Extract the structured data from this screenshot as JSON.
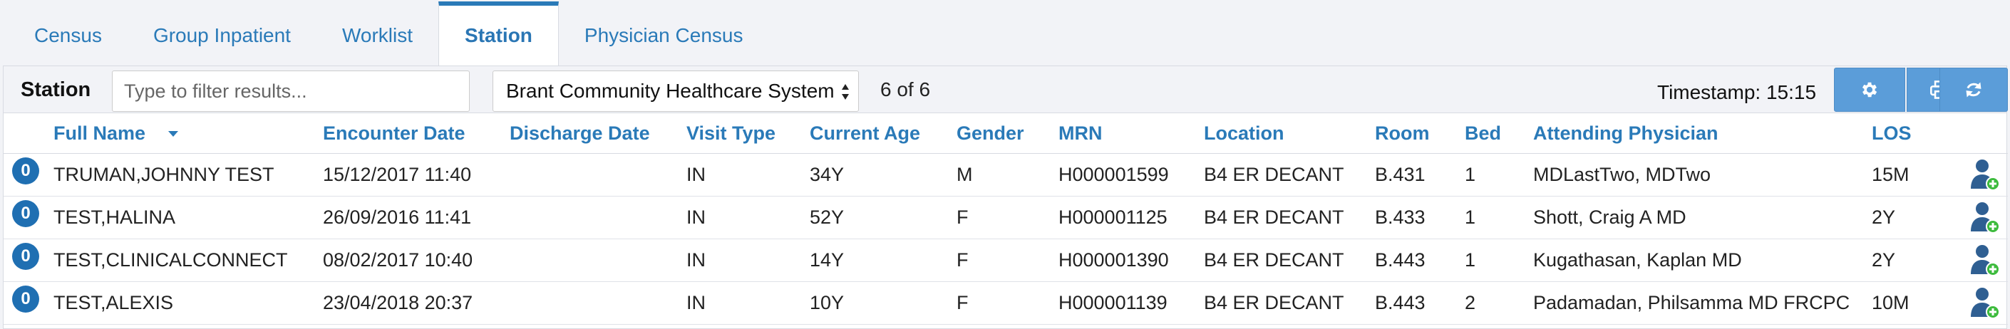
{
  "tabs": [
    {
      "label": "Census",
      "active": false
    },
    {
      "label": "Group Inpatient",
      "active": false
    },
    {
      "label": "Worklist",
      "active": false
    },
    {
      "label": "Station",
      "active": true
    },
    {
      "label": "Physician Census",
      "active": false
    }
  ],
  "toolbar": {
    "title": "Station",
    "filter_placeholder": "Type to filter results...",
    "filter_value": "",
    "system_select": "Brant Community Healthcare System",
    "count": "6 of 6",
    "timestamp": "Timestamp: 15:15",
    "buttons": [
      "gear-icon",
      "print-icon",
      "refresh-icon"
    ]
  },
  "columns": [
    "Full Name",
    "Encounter Date",
    "Discharge Date",
    "Visit Type",
    "Current Age",
    "Gender",
    "MRN",
    "Location",
    "Room",
    "Bed",
    "Attending Physician",
    "LOS"
  ],
  "rows": [
    {
      "badge": "0",
      "name": "TRUMAN,JOHNNY TEST",
      "encounter": "15/12/2017 11:40",
      "discharge": "",
      "visit": "IN",
      "age": "34Y",
      "gender": "M",
      "mrn": "H000001599",
      "location": "B4 ER DECANT",
      "room": "B.431",
      "bed": "1",
      "physician": "MDLastTwo, MDTwo",
      "los": "15M"
    },
    {
      "badge": "0",
      "name": "TEST,HALINA",
      "encounter": "26/09/2016 11:41",
      "discharge": "",
      "visit": "IN",
      "age": "52Y",
      "gender": "F",
      "mrn": "H000001125",
      "location": "B4 ER DECANT",
      "room": "B.433",
      "bed": "1",
      "physician": "Shott, Craig A MD",
      "los": "2Y"
    },
    {
      "badge": "0",
      "name": "TEST,CLINICALCONNECT",
      "encounter": "08/02/2017 10:40",
      "discharge": "",
      "visit": "IN",
      "age": "14Y",
      "gender": "F",
      "mrn": "H000001390",
      "location": "B4 ER DECANT",
      "room": "B.443",
      "bed": "1",
      "physician": "Kugathasan, Kaplan MD",
      "los": "2Y"
    },
    {
      "badge": "0",
      "name": "TEST,ALEXIS",
      "encounter": "23/04/2018 20:37",
      "discharge": "",
      "visit": "IN",
      "age": "10Y",
      "gender": "F",
      "mrn": "H000001139",
      "location": "B4 ER DECANT",
      "room": "B.443",
      "bed": "2",
      "physician": "Padamadan, Philsamma MD FRCPC",
      "los": "10M"
    }
  ],
  "colors": {
    "accent": "#2a7ab8",
    "button": "#5b9dd9",
    "badge": "#1f6fb2",
    "add_plus": "#3dbb3d"
  }
}
